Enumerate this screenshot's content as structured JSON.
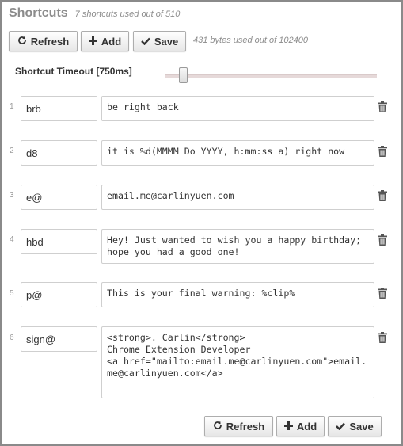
{
  "header": {
    "title": "Shortcuts",
    "usage": "7 shortcuts used out of 510"
  },
  "toolbar": {
    "refresh_label": "Refresh",
    "add_label": "Add",
    "save_label": "Save",
    "bytes_prefix": "431 bytes used out of ",
    "bytes_max": "102400"
  },
  "timeout": {
    "label": "Shortcut Timeout [750ms]",
    "value_ms": 750
  },
  "shortcuts": [
    {
      "index": "1",
      "shortcut": "brb",
      "expansion": "be right back"
    },
    {
      "index": "2",
      "shortcut": "d8",
      "expansion": "it is %d(MMMM Do YYYY, h:mm:ss a) right now"
    },
    {
      "index": "3",
      "shortcut": "e@",
      "expansion": "email.me@carlinyuen.com"
    },
    {
      "index": "4",
      "shortcut": "hbd",
      "expansion": "Hey! Just wanted to wish you a happy birthday; hope you had a good one!"
    },
    {
      "index": "5",
      "shortcut": "p@",
      "expansion": "This is your final warning: %clip%"
    },
    {
      "index": "6",
      "shortcut": "sign@",
      "expansion": "<strong>. Carlin</strong>\nChrome Extension Developer\n<a href=\"mailto:email.me@carlinyuen.com\">email.me@carlinyuen.com</a>"
    }
  ],
  "footer": {
    "refresh_label": "Refresh",
    "add_label": "Add",
    "save_label": "Save"
  },
  "icons": {
    "refresh": "refresh-icon",
    "add": "plus-icon",
    "save": "checkmark-icon",
    "delete": "trash-icon"
  }
}
